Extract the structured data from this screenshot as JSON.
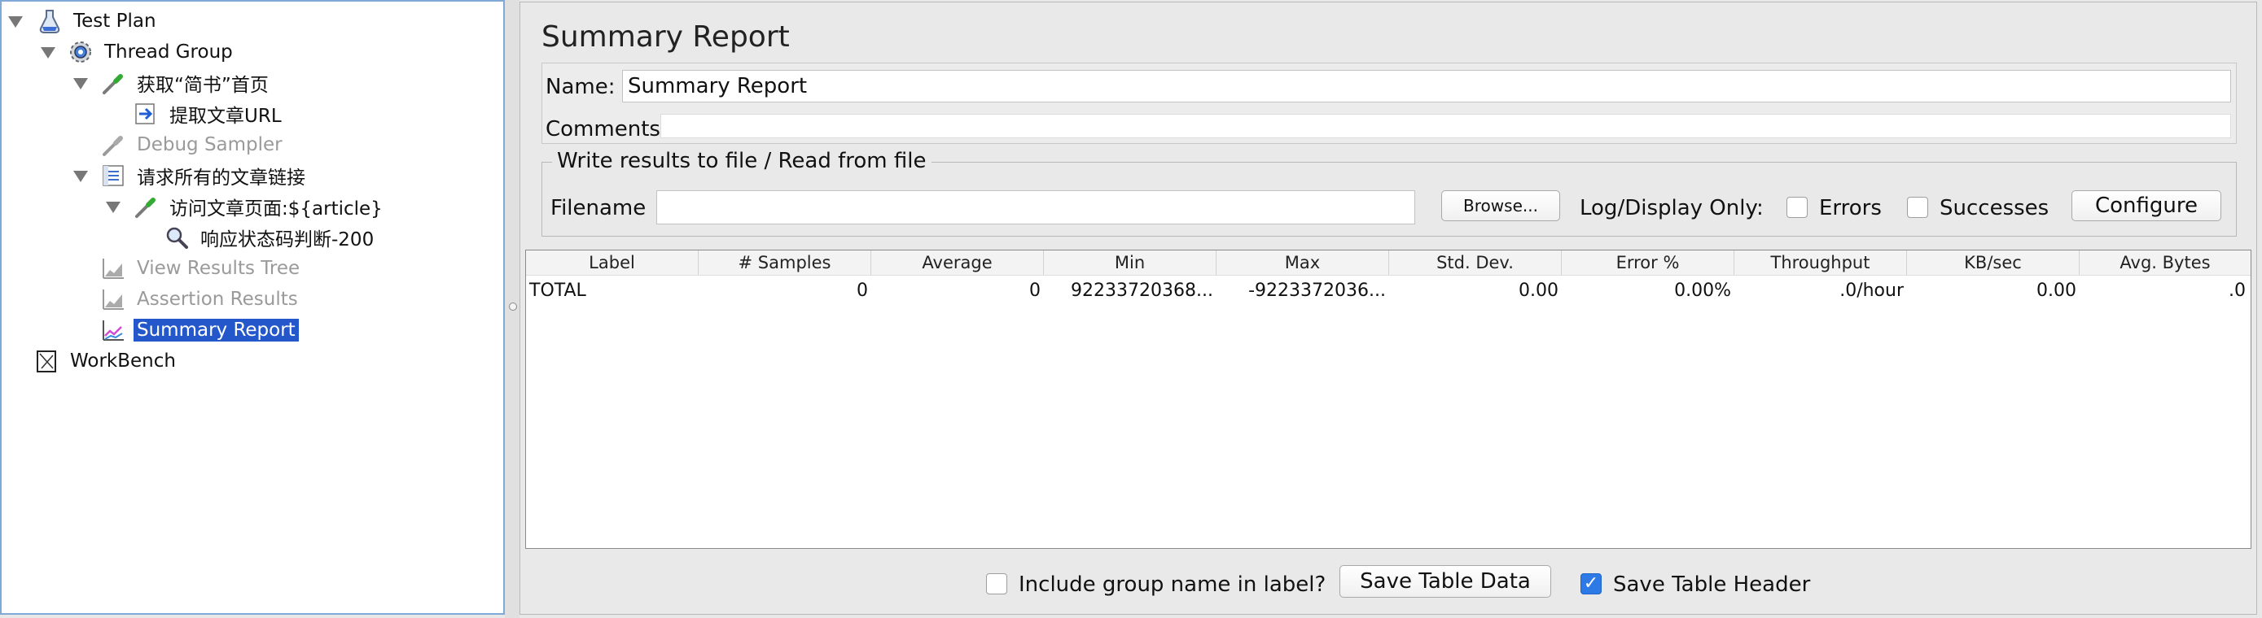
{
  "tree": {
    "items": [
      {
        "label": "Test Plan",
        "icon": "flask-icon"
      },
      {
        "label": "Thread Group",
        "icon": "gear-icon"
      },
      {
        "label": "获取“简书”首页",
        "icon": "pipette-icon"
      },
      {
        "label": "提取文章URL",
        "icon": "extractor-arrow-icon"
      },
      {
        "label": "Debug Sampler",
        "icon": "pipette-icon"
      },
      {
        "label": "请求所有的文章链接",
        "icon": "csv-config-icon"
      },
      {
        "label": "访问文章页面:${article}",
        "icon": "pipette-icon"
      },
      {
        "label": "响应状态码判断-200",
        "icon": "magnifier-icon"
      },
      {
        "label": "View Results Tree",
        "icon": "listener-chart-icon"
      },
      {
        "label": "Assertion Results",
        "icon": "listener-chart-icon"
      },
      {
        "label": "Summary Report",
        "icon": "summary-chart-icon"
      },
      {
        "label": "WorkBench",
        "icon": "workbench-icon"
      }
    ]
  },
  "report": {
    "title": "Summary Report",
    "name_label": "Name:",
    "name_value": "Summary Report",
    "comments_label": "Comments:",
    "comments_value": "",
    "file_group_title": "Write results to file / Read from file",
    "filename_label": "Filename",
    "filename_value": "",
    "browse_label": "Browse...",
    "log_display_label": "Log/Display Only:",
    "errors_label": "Errors",
    "successes_label": "Successes",
    "configure_label": "Configure"
  },
  "table": {
    "columns": [
      "Label",
      "# Samples",
      "Average",
      "Min",
      "Max",
      "Std. Dev.",
      "Error %",
      "Throughput",
      "KB/sec",
      "Avg. Bytes"
    ],
    "rows": [
      [
        "TOTAL",
        "0",
        "0",
        "92233720368...",
        "-9223372036...",
        "0.00",
        "0.00%",
        ".0/hour",
        "0.00",
        ".0"
      ]
    ]
  },
  "footer": {
    "include_group_label": "Include group name in label?",
    "include_group_checked": false,
    "save_table_data_label": "Save Table Data",
    "save_table_header_label": "Save Table Header",
    "save_table_header_checked": true
  },
  "colors": {
    "selection": "#2457c9",
    "checkbox_checked": "#2d79e6",
    "tree_border": "#7fa9d6"
  }
}
